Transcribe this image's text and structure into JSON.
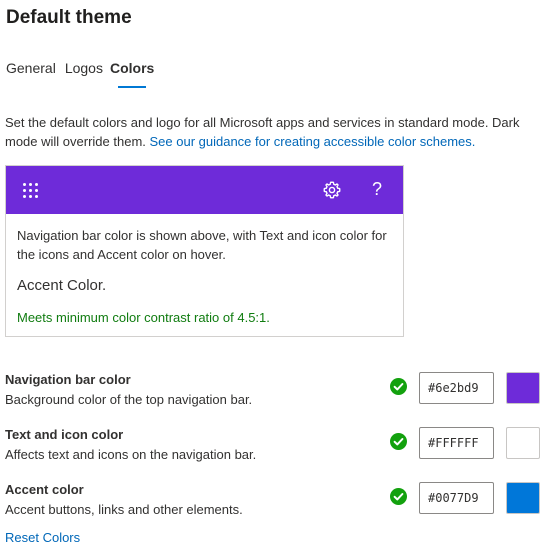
{
  "page": {
    "title": "Default theme"
  },
  "tabs": [
    {
      "label": "General",
      "active": false
    },
    {
      "label": "Logos",
      "active": false
    },
    {
      "label": "Colors",
      "active": true
    }
  ],
  "description": {
    "text": "Set the default colors and logo for all Microsoft apps and services in standard mode. Dark mode will override them. ",
    "link_text": "See our guidance for creating accessible color schemes."
  },
  "preview": {
    "nav_text": "Navigation bar color is shown above, with Text and icon color for the icons and Accent color on hover.",
    "accent_label": "Accent Color.",
    "contrast_message": "Meets minimum color contrast ratio of 4.5:1.",
    "help_glyph": "?"
  },
  "settings": [
    {
      "title": "Navigation bar color",
      "subtitle": "Background color of the top navigation bar.",
      "value": "#6e2bd9",
      "swatch": "#6e2bd9"
    },
    {
      "title": "Text and icon color",
      "subtitle": "Affects text and icons on the navigation bar.",
      "value": "#FFFFFF",
      "swatch": "#FFFFFF"
    },
    {
      "title": "Accent color",
      "subtitle": "Accent buttons, links and other elements.",
      "value": "#0077D9",
      "swatch": "#0077D9"
    }
  ],
  "reset_label": "Reset Colors",
  "colors": {
    "check_green": "#13a10e",
    "link_blue": "#0067b8",
    "success_text": "#107c10"
  },
  "icons": {
    "waffle": "waffle-icon",
    "gear": "gear-icon",
    "help": "help-icon",
    "check": "checkmark-circle-icon"
  }
}
